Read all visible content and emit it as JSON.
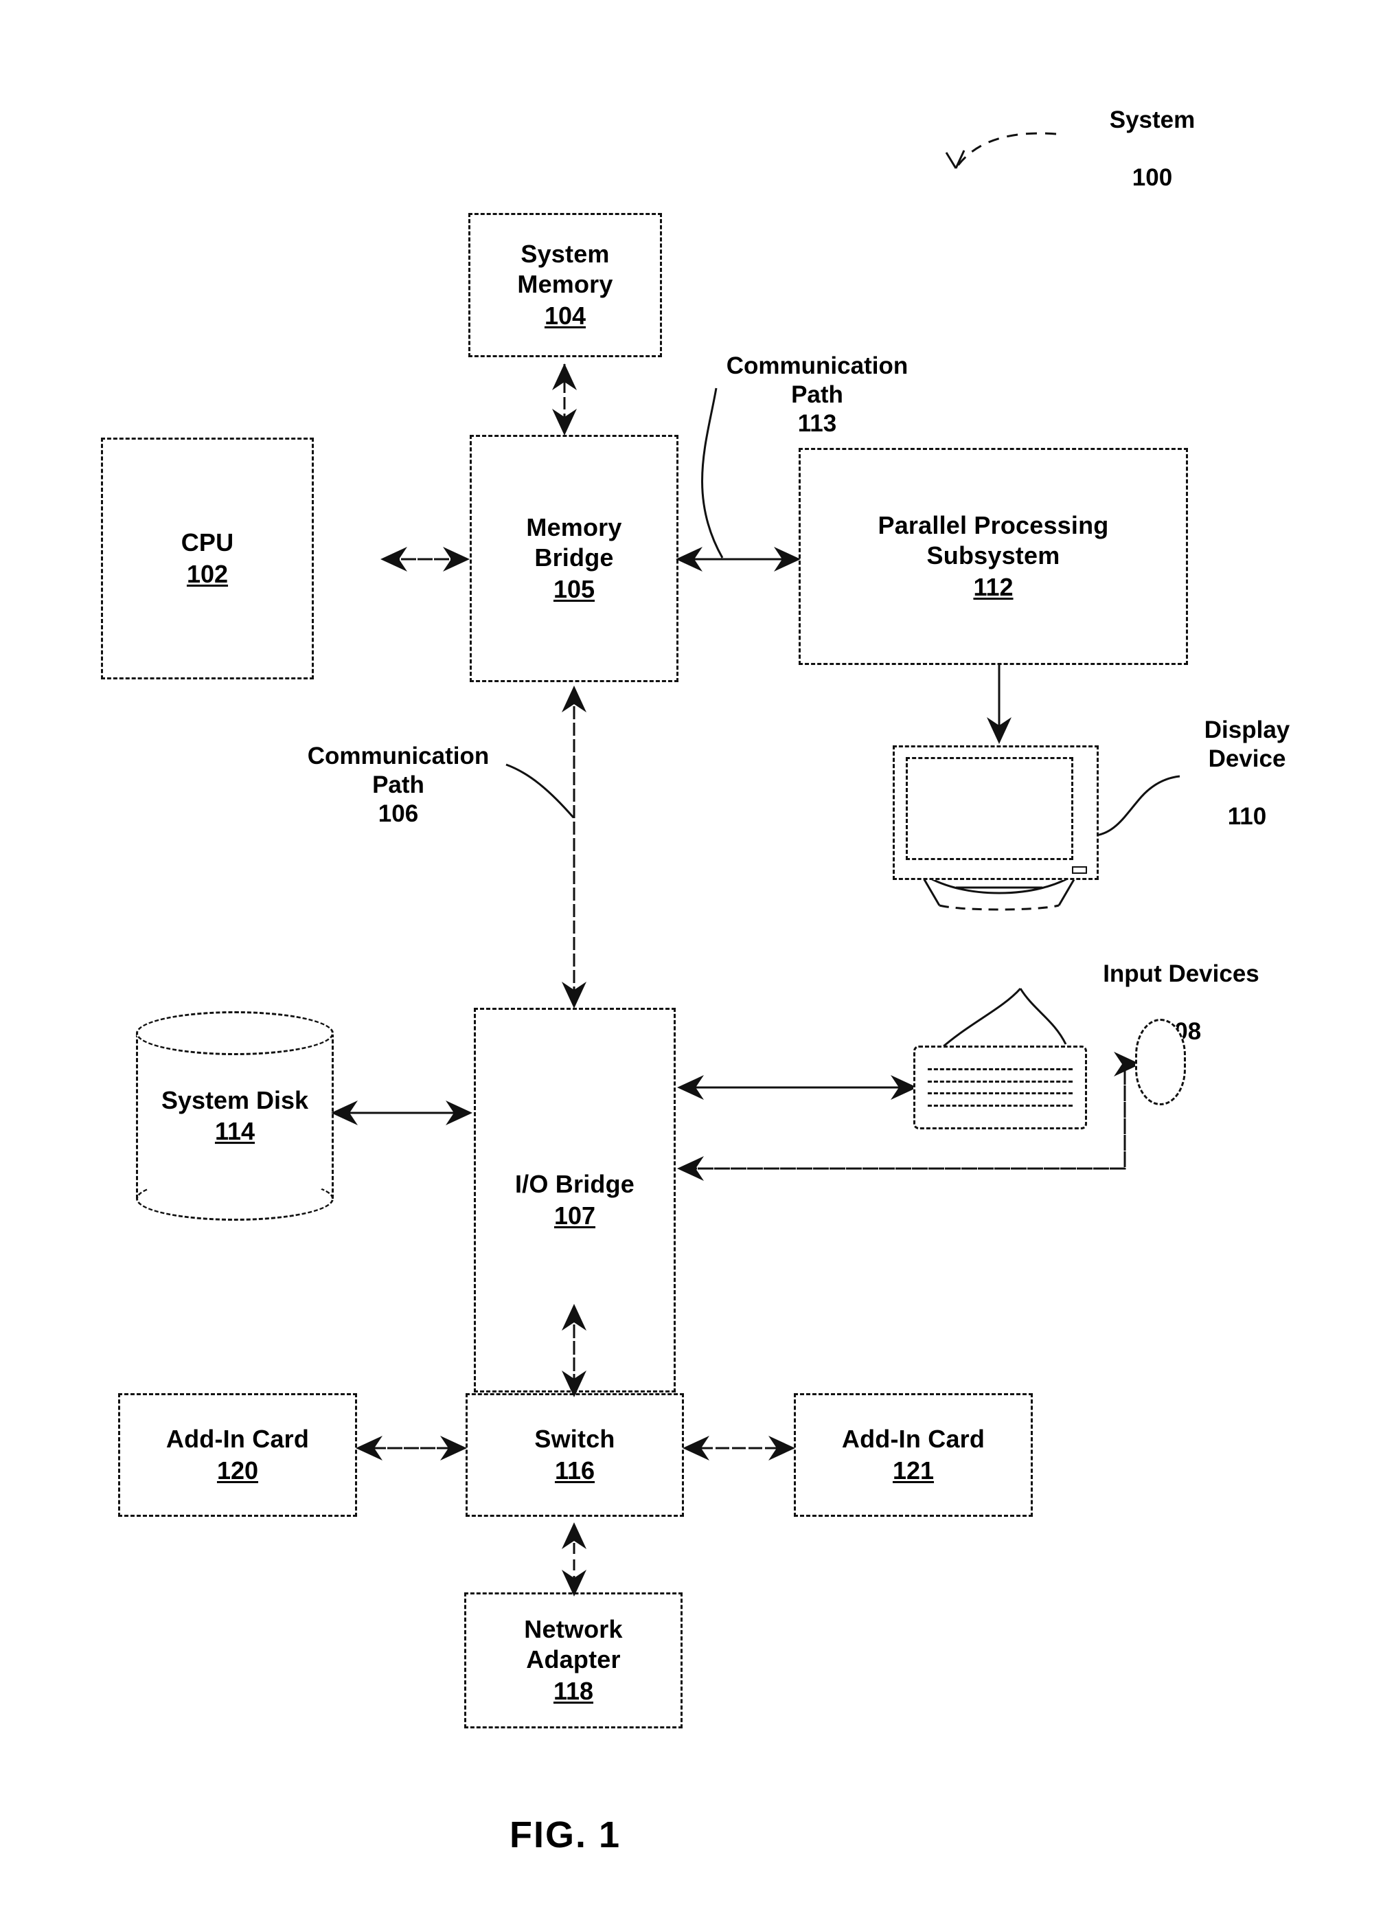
{
  "figure": {
    "caption": "FIG. 1",
    "system_label": "System",
    "system_number": "100"
  },
  "nodes": {
    "system_memory": {
      "title": "System\nMemory",
      "number": "104"
    },
    "cpu": {
      "title": "CPU",
      "number": "102"
    },
    "memory_bridge": {
      "title": "Memory\nBridge",
      "number": "105"
    },
    "parallel_processing_subsystem": {
      "title": "Parallel Processing\nSubsystem",
      "number": "112"
    },
    "io_bridge": {
      "title": "I/O Bridge",
      "number": "107"
    },
    "system_disk": {
      "title": "System\nDisk",
      "number": "114"
    },
    "switch": {
      "title": "Switch",
      "number": "116"
    },
    "add_in_card_120": {
      "title": "Add-In Card",
      "number": "120"
    },
    "add_in_card_121": {
      "title": "Add-In Card",
      "number": "121"
    },
    "network_adapter": {
      "title": "Network\nAdapter",
      "number": "118"
    }
  },
  "annotations": {
    "communication_path_113": {
      "title": "Communication\nPath",
      "number": "113"
    },
    "communication_path_106": {
      "title": "Communication\nPath",
      "number": "106"
    },
    "display_device": {
      "title": "Display\nDevice",
      "number": "110"
    },
    "input_devices": {
      "title": "Input Devices",
      "number": "108"
    }
  },
  "icons": {
    "display_device": "monitor-icon",
    "keyboard": "keyboard-icon",
    "mouse": "mouse-icon",
    "system_disk": "cylinder-disk-icon"
  },
  "colors": {
    "ink": "#111111",
    "paper": "#ffffff"
  },
  "connections": [
    {
      "from": "memory_bridge",
      "to": "system_memory",
      "style": "double-arrow-vertical"
    },
    {
      "from": "cpu",
      "to": "memory_bridge",
      "style": "double-arrow-horizontal"
    },
    {
      "from": "memory_bridge",
      "to": "parallel_processing_subsystem",
      "style": "double-arrow-horizontal",
      "label": "communication_path_113"
    },
    {
      "from": "parallel_processing_subsystem",
      "to": "display_device",
      "style": "single-arrow-down"
    },
    {
      "from": "memory_bridge",
      "to": "io_bridge",
      "style": "double-arrow-vertical",
      "label": "communication_path_106"
    },
    {
      "from": "io_bridge",
      "to": "system_disk",
      "style": "double-arrow-horizontal"
    },
    {
      "from": "io_bridge",
      "to": "keyboard",
      "style": "double-arrow-horizontal"
    },
    {
      "from": "io_bridge",
      "to": "mouse",
      "style": "double-arrow-routed"
    },
    {
      "from": "io_bridge",
      "to": "switch",
      "style": "double-arrow-vertical"
    },
    {
      "from": "switch",
      "to": "add_in_card_120",
      "style": "double-arrow-horizontal"
    },
    {
      "from": "switch",
      "to": "add_in_card_121",
      "style": "double-arrow-horizontal"
    },
    {
      "from": "switch",
      "to": "network_adapter",
      "style": "double-arrow-vertical"
    }
  ]
}
